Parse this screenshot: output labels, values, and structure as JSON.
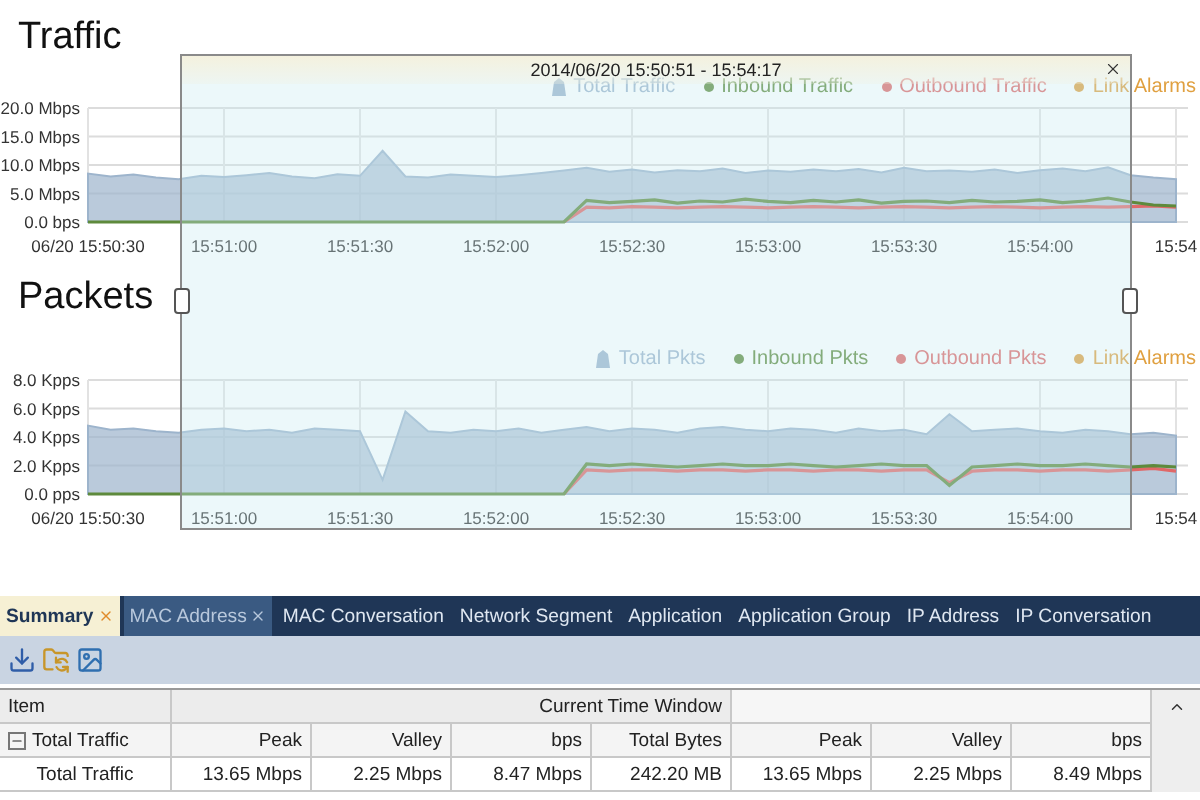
{
  "traffic": {
    "title": "Traffic",
    "chart_data": {
      "type": "area",
      "categories": [
        "06/20 15:50:30",
        null,
        null,
        null,
        null,
        null,
        "15:51:00",
        null,
        null,
        null,
        null,
        null,
        "15:51:30",
        null,
        null,
        null,
        null,
        null,
        "15:52:00",
        null,
        null,
        null,
        null,
        null,
        "15:52:30",
        null,
        null,
        null,
        null,
        null,
        "15:53:00",
        null,
        null,
        null,
        null,
        null,
        "15:53:30",
        null,
        null,
        null,
        null,
        null,
        "15:54:00",
        null,
        null,
        null,
        null,
        null,
        "15:54"
      ],
      "ylim": [
        0,
        20
      ],
      "grid": true,
      "yticks": [
        {
          "value": 0,
          "label": "0.0 bps"
        },
        {
          "value": 5,
          "label": "5.0 Mbps"
        },
        {
          "value": 10,
          "label": "10.0 Mbps"
        },
        {
          "value": 15,
          "label": "15.0 Mbps"
        },
        {
          "value": 20,
          "label": "20.0 Mbps"
        }
      ],
      "series": [
        {
          "name": "Total Traffic",
          "type": "area",
          "color": "#9db4cc",
          "values": [
            8.5,
            8.0,
            8.3,
            7.8,
            7.5,
            8.1,
            7.9,
            8.2,
            8.6,
            8.0,
            7.7,
            8.4,
            8.1,
            12.5,
            8.0,
            7.8,
            8.3,
            8.1,
            7.9,
            8.2,
            8.6,
            9.0,
            9.5,
            8.8,
            9.2,
            8.7,
            9.1,
            8.9,
            9.4,
            8.6,
            9.0,
            8.8,
            9.2,
            8.9,
            9.3,
            8.7,
            9.5,
            8.9,
            9.0,
            8.8,
            9.2,
            8.6,
            9.1,
            9.4,
            8.9,
            9.6,
            8.2,
            7.8,
            7.5
          ]
        },
        {
          "name": "Inbound Traffic",
          "type": "line",
          "color": "#5e8a3c",
          "values": [
            0,
            0,
            0,
            0,
            0,
            0,
            0,
            0,
            0,
            0,
            0,
            0,
            0,
            0,
            0,
            0,
            0,
            0,
            0,
            0,
            0,
            0,
            3.8,
            3.4,
            3.6,
            3.9,
            3.3,
            3.7,
            3.5,
            4.0,
            3.6,
            3.4,
            3.8,
            3.5,
            3.9,
            3.3,
            3.6,
            3.7,
            3.4,
            3.8,
            3.5,
            3.6,
            3.9,
            3.4,
            3.7,
            4.2,
            3.5,
            3.0,
            2.8
          ]
        },
        {
          "name": "Outbound Traffic",
          "type": "line",
          "color": "#e06868",
          "values": [
            null,
            null,
            null,
            null,
            null,
            null,
            null,
            null,
            null,
            null,
            null,
            null,
            null,
            null,
            null,
            null,
            null,
            null,
            null,
            null,
            null,
            0,
            2.6,
            2.5,
            2.7,
            2.6,
            2.5,
            2.6,
            2.7,
            2.6,
            2.5,
            2.6,
            2.7,
            2.6,
            2.5,
            2.6,
            2.7,
            2.6,
            2.5,
            2.6,
            2.7,
            2.6,
            2.5,
            2.6,
            2.7,
            2.6,
            2.7,
            2.8,
            2.6
          ]
        },
        {
          "name": "Link Alarms",
          "color": "#e0a040",
          "values": [
            null,
            null,
            null,
            null,
            null,
            null,
            null,
            null,
            null,
            null,
            null,
            null,
            null,
            null,
            null,
            null,
            null,
            null,
            null,
            null,
            null,
            null,
            null,
            null,
            null,
            null,
            null,
            null,
            null,
            null,
            null,
            null,
            null,
            null,
            null,
            null,
            null,
            null,
            null,
            null,
            null,
            null,
            null,
            null,
            null,
            null,
            null,
            null,
            null
          ]
        }
      ]
    }
  },
  "packets": {
    "title": "Packets",
    "chart_data": {
      "type": "area",
      "categories": [
        "06/20 15:50:30",
        null,
        null,
        null,
        null,
        null,
        "15:51:00",
        null,
        null,
        null,
        null,
        null,
        "15:51:30",
        null,
        null,
        null,
        null,
        null,
        "15:52:00",
        null,
        null,
        null,
        null,
        null,
        "15:52:30",
        null,
        null,
        null,
        null,
        null,
        "15:53:00",
        null,
        null,
        null,
        null,
        null,
        "15:53:30",
        null,
        null,
        null,
        null,
        null,
        "15:54:00",
        null,
        null,
        null,
        null,
        null,
        "15:54"
      ],
      "ylim": [
        0,
        8
      ],
      "grid": true,
      "yticks": [
        {
          "value": 0,
          "label": "0.0 pps"
        },
        {
          "value": 2,
          "label": "2.0 Kpps"
        },
        {
          "value": 4,
          "label": "4.0 Kpps"
        },
        {
          "value": 6,
          "label": "6.0 Kpps"
        },
        {
          "value": 8,
          "label": "8.0 Kpps"
        }
      ],
      "series": [
        {
          "name": "Total Pkts",
          "type": "area",
          "color": "#9db4cc",
          "values": [
            4.8,
            4.5,
            4.6,
            4.4,
            4.3,
            4.5,
            4.6,
            4.4,
            4.5,
            4.3,
            4.6,
            4.5,
            4.4,
            1.0,
            5.8,
            4.4,
            4.3,
            4.5,
            4.4,
            4.6,
            4.3,
            4.5,
            4.7,
            4.4,
            4.6,
            4.5,
            4.3,
            4.6,
            4.7,
            4.5,
            4.4,
            4.6,
            4.5,
            4.3,
            4.6,
            4.4,
            4.5,
            4.2,
            5.6,
            4.4,
            4.5,
            4.6,
            4.4,
            4.3,
            4.5,
            4.4,
            4.2,
            4.3,
            4.1
          ]
        },
        {
          "name": "Inbound Pkts",
          "type": "line",
          "color": "#5e8a3c",
          "values": [
            0,
            0,
            0,
            0,
            0,
            0,
            0,
            0,
            0,
            0,
            0,
            0,
            0,
            0,
            0,
            0,
            0,
            0,
            0,
            0,
            0,
            0,
            2.1,
            2.0,
            2.1,
            2.0,
            1.9,
            2.0,
            2.1,
            2.0,
            2.0,
            2.1,
            2.0,
            1.9,
            2.0,
            2.1,
            2.0,
            2.0,
            0.6,
            1.9,
            2.0,
            2.1,
            2.0,
            2.0,
            2.1,
            2.0,
            1.9,
            2.0,
            1.9
          ]
        },
        {
          "name": "Outbound Pkts",
          "type": "line",
          "color": "#e06868",
          "values": [
            null,
            null,
            null,
            null,
            null,
            null,
            null,
            null,
            null,
            null,
            null,
            null,
            null,
            null,
            null,
            null,
            null,
            null,
            null,
            null,
            null,
            0,
            1.7,
            1.6,
            1.7,
            1.7,
            1.6,
            1.7,
            1.7,
            1.6,
            1.7,
            1.7,
            1.6,
            1.7,
            1.7,
            1.6,
            1.7,
            1.7,
            0.8,
            1.6,
            1.7,
            1.7,
            1.6,
            1.7,
            1.7,
            1.6,
            1.7,
            1.8,
            1.6
          ]
        },
        {
          "name": "Link Alarms",
          "color": "#e0a040",
          "values": [
            null,
            null,
            null,
            null,
            null,
            null,
            null,
            null,
            null,
            null,
            null,
            null,
            null,
            null,
            null,
            null,
            null,
            null,
            null,
            null,
            null,
            null,
            null,
            null,
            null,
            null,
            null,
            null,
            null,
            null,
            null,
            null,
            null,
            null,
            null,
            null,
            null,
            null,
            null,
            null,
            null,
            null,
            null,
            null,
            null,
            null,
            null,
            null,
            null
          ]
        }
      ]
    }
  },
  "time_window": {
    "range": "2014/06/20 15:50:51 - 15:54:17"
  },
  "tabs": [
    {
      "label": "Summary",
      "selected": true,
      "closable": true
    },
    {
      "label": "MAC Address",
      "selected": false,
      "closable": true
    },
    {
      "label": "MAC Conversation",
      "selected": false,
      "closable": false
    },
    {
      "label": "Network Segment",
      "selected": false,
      "closable": false
    },
    {
      "label": "Application",
      "selected": false,
      "closable": false
    },
    {
      "label": "Application Group",
      "selected": false,
      "closable": false
    },
    {
      "label": "IP Address",
      "selected": false,
      "closable": false
    },
    {
      "label": "IP Conversation",
      "selected": false,
      "closable": false
    }
  ],
  "table": {
    "header": {
      "item": "Item",
      "group": "Current Time Window"
    },
    "group_row": {
      "label": "Total Traffic",
      "expanded": true,
      "subheaders": [
        "Peak",
        "Valley",
        "bps",
        "Total Bytes",
        "Peak",
        "Valley",
        "bps"
      ]
    },
    "rows": [
      {
        "label": "Total Traffic",
        "cells": [
          "13.65 Mbps",
          "2.25 Mbps",
          "8.47 Mbps",
          "242.20 MB",
          "13.65 Mbps",
          "2.25 Mbps",
          "8.49 Mbps"
        ]
      }
    ]
  }
}
